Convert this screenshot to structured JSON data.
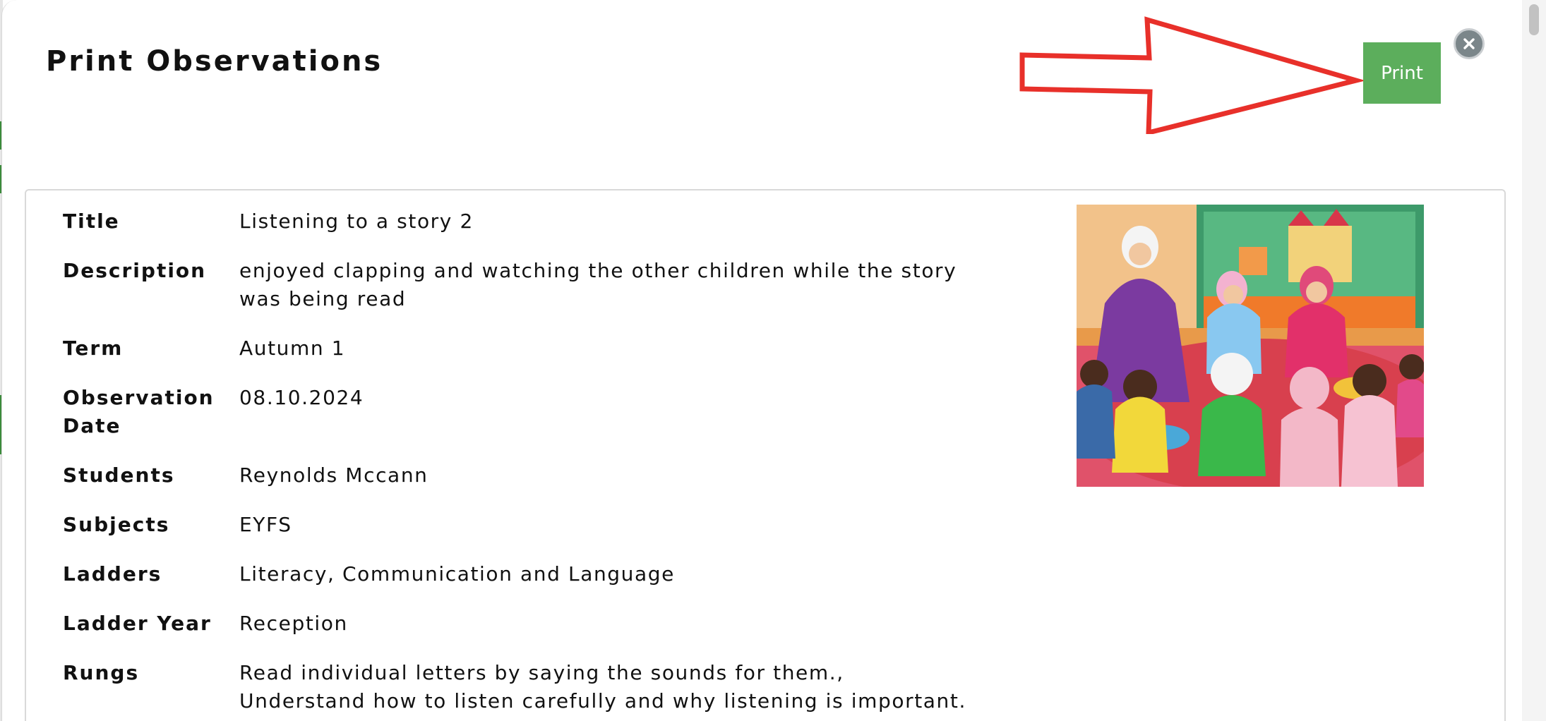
{
  "modal": {
    "title": "Print Observations",
    "print_label": "Print",
    "close_icon": "close-icon"
  },
  "colors": {
    "print_button": "#5cae5c",
    "annotation_arrow": "#e8302a",
    "close_button": "#7b868a"
  },
  "fields": [
    {
      "label": "Title",
      "value": "Listening to a story 2"
    },
    {
      "label": "Description",
      "value": "enjoyed clapping and watching the other children while the story was being read"
    },
    {
      "label": "Term",
      "value": "Autumn 1"
    },
    {
      "label": "Observation Date",
      "value": "08.10.2024"
    },
    {
      "label": "Students",
      "value": "Reynolds Mccann"
    },
    {
      "label": "Subjects",
      "value": "EYFS"
    },
    {
      "label": "Ladders",
      "value": "Literacy, Communication and Language"
    },
    {
      "label": "Ladder Year",
      "value": "Reception"
    },
    {
      "label": "Rungs",
      "value": "Read individual letters by saying the sounds for them., Understand how to listen carefully and why listening is important."
    }
  ]
}
